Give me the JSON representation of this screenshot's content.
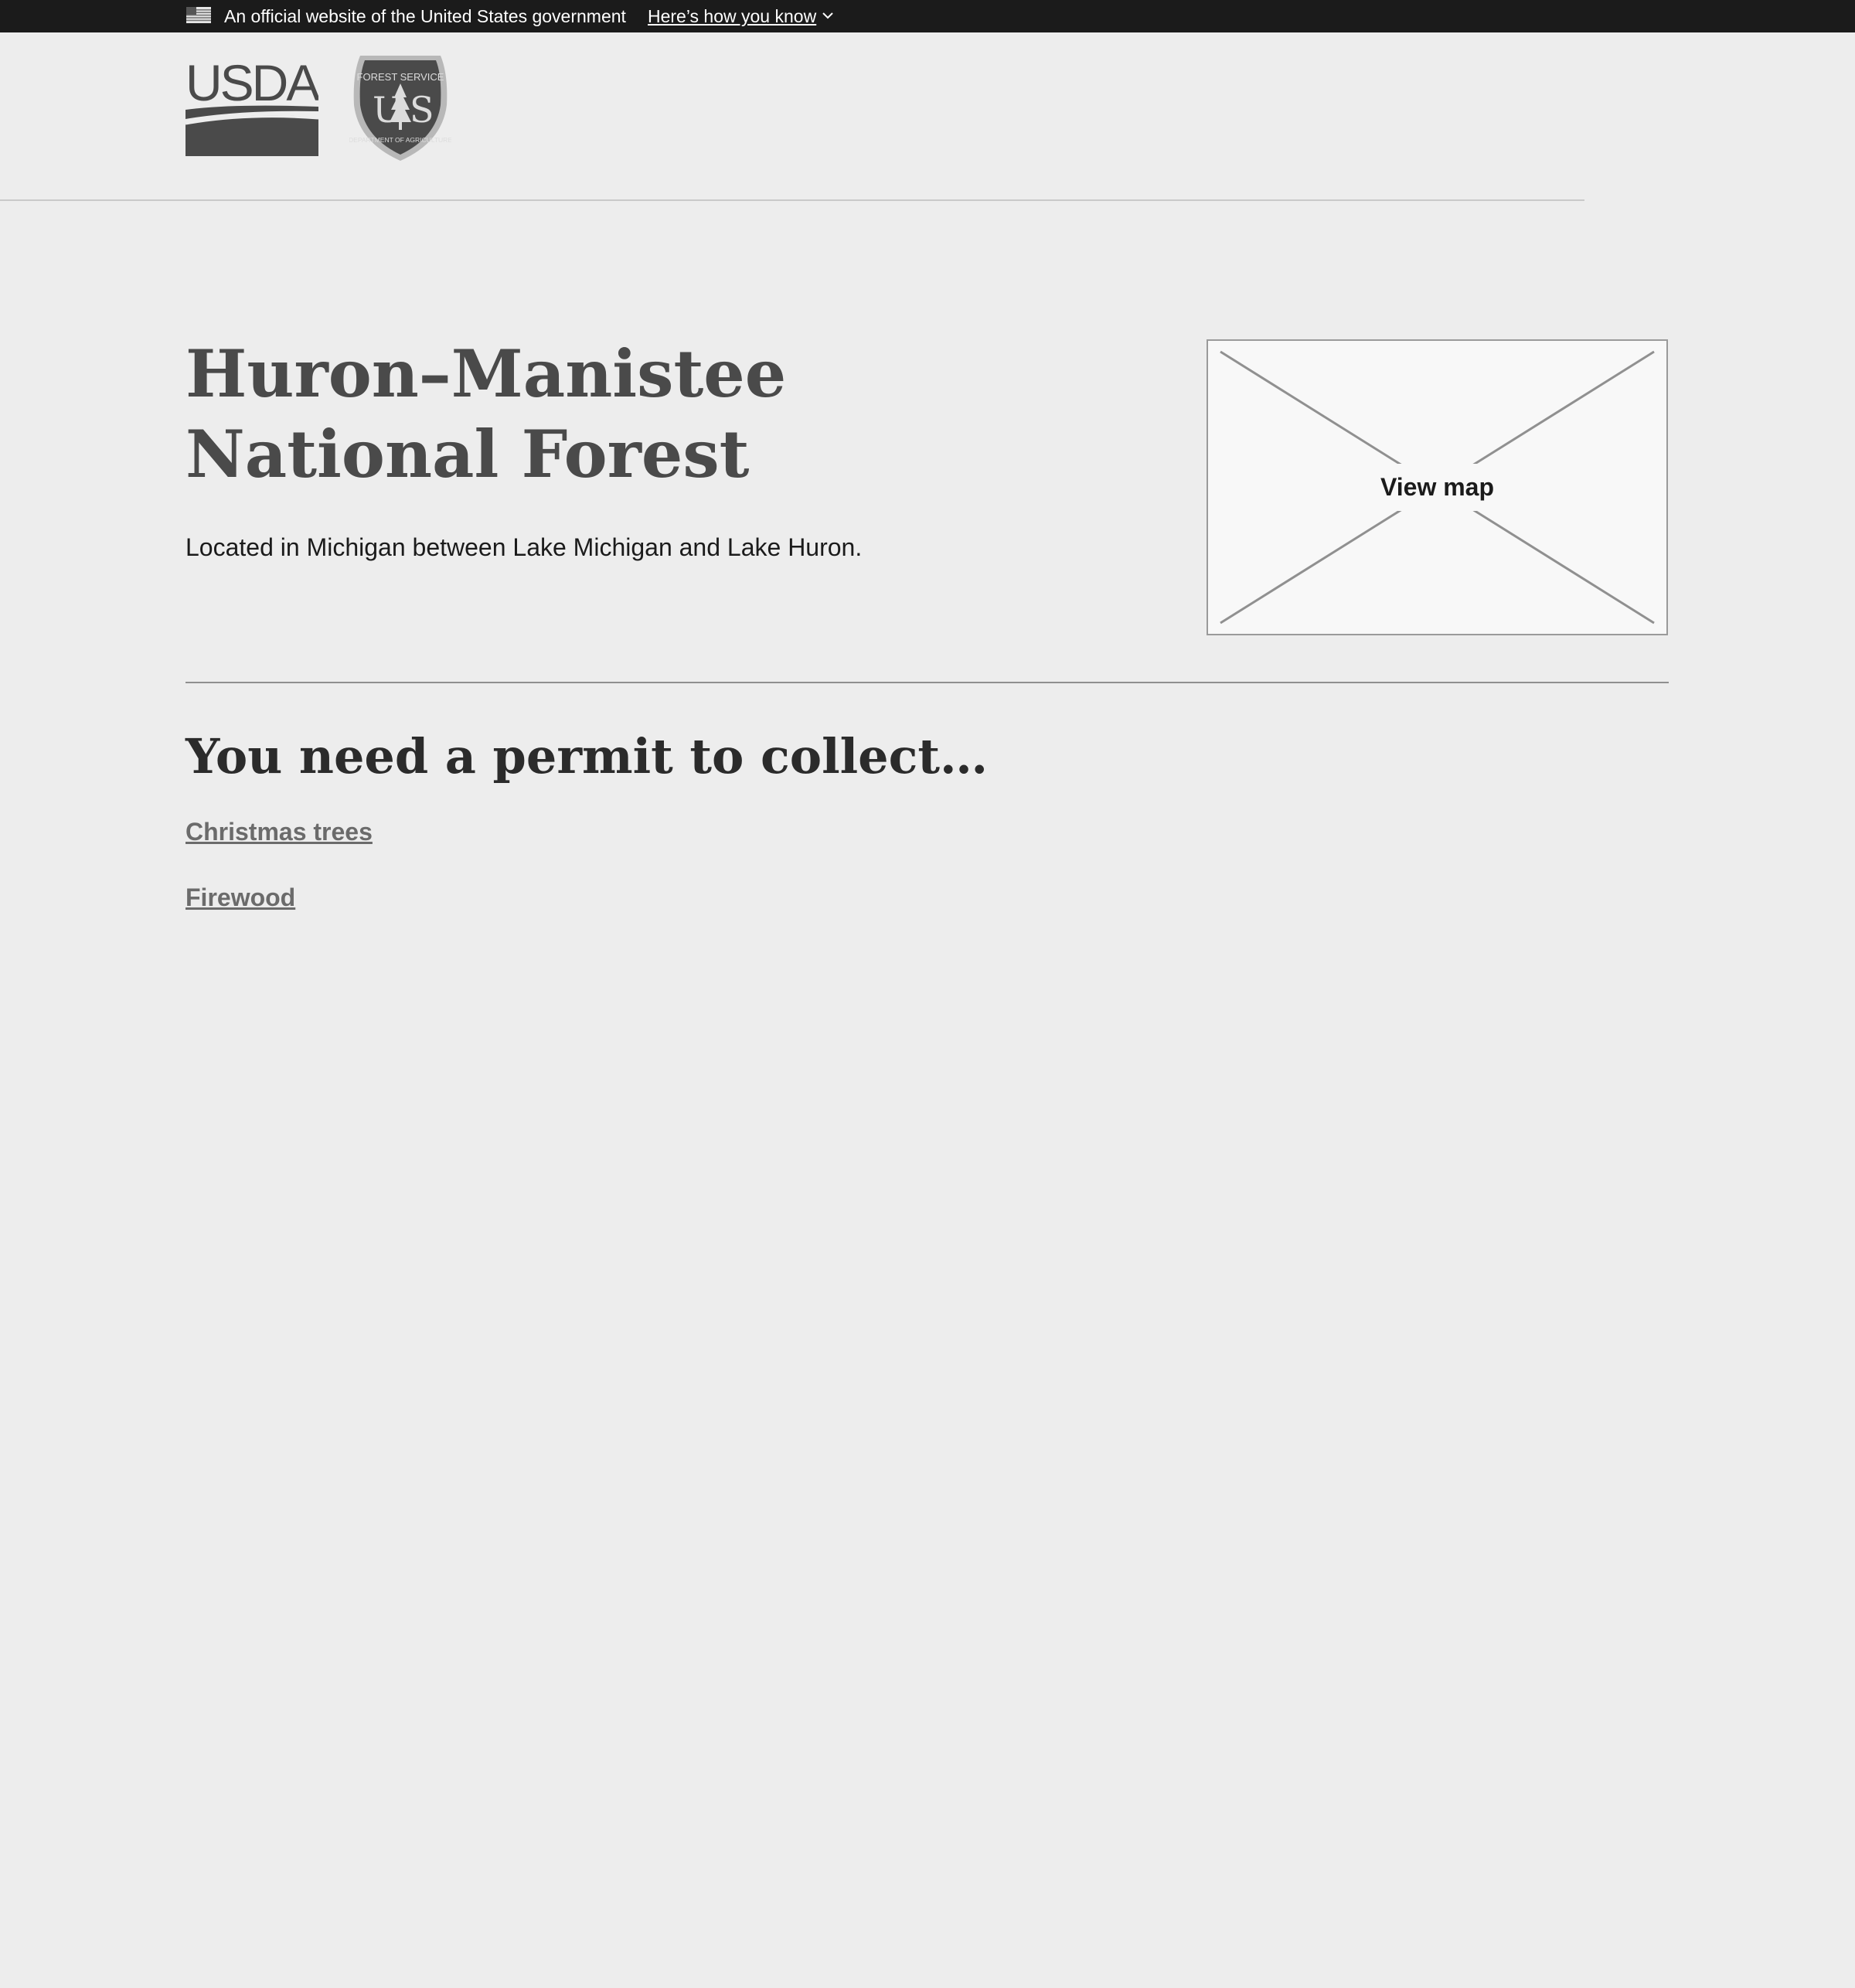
{
  "gov_banner": {
    "official_text": "An official website of the United States government",
    "how_you_know": "Here’s how you know",
    "flag_icon": "us-flag-icon",
    "chevron_icon": "chevron-down-icon"
  },
  "header": {
    "usda_logo_text": "USDA",
    "forest_service_logo_top": "FOREST SERVICE",
    "forest_service_logo_bottom": "DEPARTMENT OF AGRICULTURE",
    "forest_service_logo_letters": "US"
  },
  "forest": {
    "title": "Huron–Manistee National Forest",
    "description": "Located in Michigan between Lake Michigan and Lake Huron."
  },
  "map": {
    "label": "View map"
  },
  "permits": {
    "heading": "You need a permit to collect…",
    "links": [
      {
        "label": "Christmas trees"
      },
      {
        "label": "Firewood"
      }
    ]
  },
  "colors": {
    "banner_bg": "#1b1b1b",
    "page_bg": "#ededed",
    "title_color": "#4a4a4a",
    "link_color": "#6b6b6b"
  }
}
